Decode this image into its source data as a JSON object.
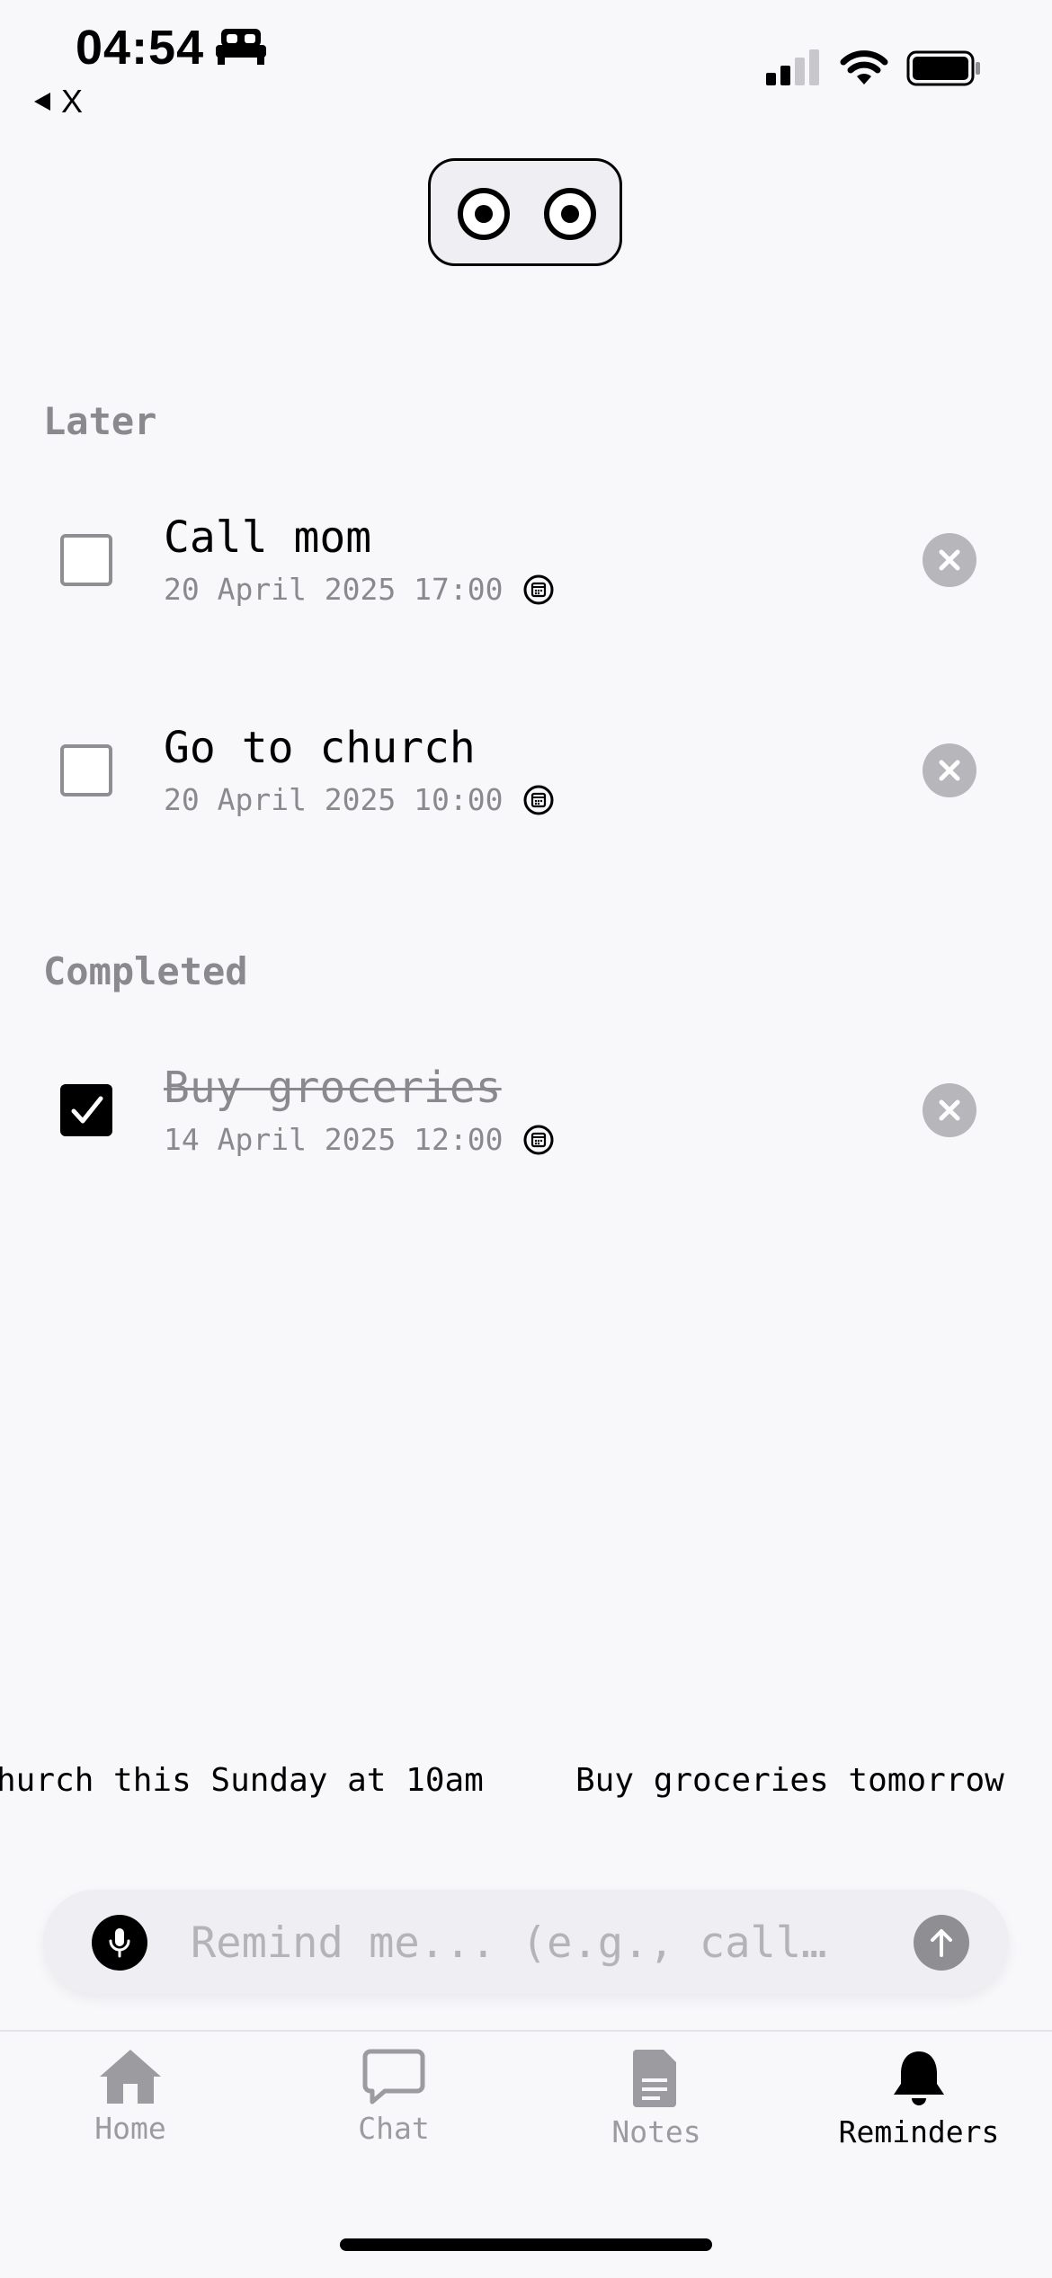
{
  "status_bar": {
    "time": "04:54",
    "back_label": "X"
  },
  "sections": {
    "later": {
      "title": "Later",
      "items": [
        {
          "title": "Call mom",
          "datetime": "20 April 2025 17:00",
          "completed": false
        },
        {
          "title": "Go to church",
          "datetime": "20 April 2025 10:00",
          "completed": false
        }
      ]
    },
    "completed": {
      "title": "Completed",
      "items": [
        {
          "title": "Buy groceries",
          "datetime": "14 April 2025 12:00",
          "completed": true
        }
      ]
    }
  },
  "suggestions": [
    "hurch this Sunday at 10am",
    "Buy groceries tomorrow"
  ],
  "input": {
    "placeholder": "Remind me... (e.g., call…",
    "value": ""
  },
  "tabs": [
    {
      "label": "Home",
      "icon": "house-icon",
      "active": false
    },
    {
      "label": "Chat",
      "icon": "chat-bubble-icon",
      "active": false
    },
    {
      "label": "Notes",
      "icon": "document-icon",
      "active": false
    },
    {
      "label": "Reminders",
      "icon": "bell-icon",
      "active": true
    }
  ],
  "colors": {
    "background": "#f8f8fb",
    "muted_text": "#8a8a8e",
    "delete_button": "#b6b6bb",
    "active_tab": "#000000",
    "inactive_tab": "#9b9ba0"
  }
}
